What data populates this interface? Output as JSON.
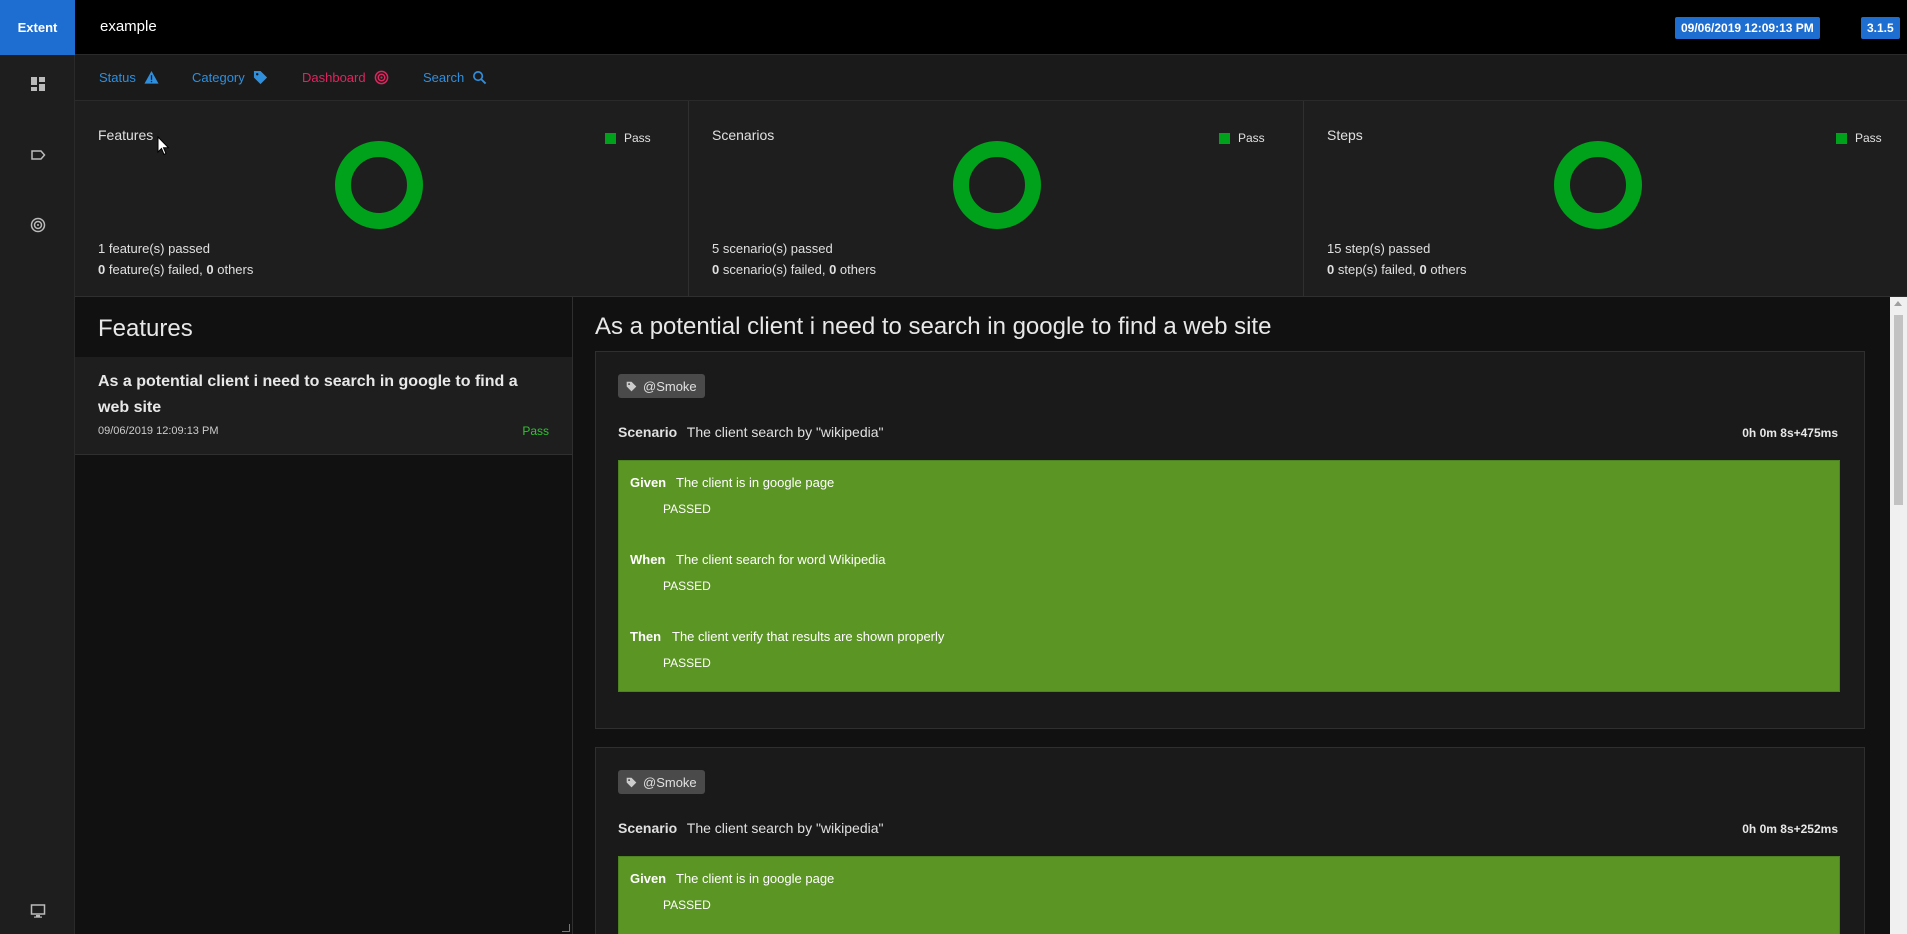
{
  "app": {
    "brand": "Extent",
    "title": "example",
    "timestamp": "09/06/2019 12:09:13 PM",
    "version": "3.1.5"
  },
  "nav": {
    "items": [
      {
        "label": "Status",
        "color": "#2f8fdc",
        "icon": "warning-triangle-icon"
      },
      {
        "label": "Category",
        "color": "#2f8fdc",
        "icon": "tag-icon"
      },
      {
        "label": "Dashboard",
        "color": "#e0245e",
        "icon": "dashboard-radar-icon"
      },
      {
        "label": "Search",
        "color": "#2f8fdc",
        "icon": "search-icon"
      }
    ]
  },
  "sidebar": {
    "icons": [
      "dashboard-grid-icon",
      "label-tag-icon",
      "radar-icon",
      "monitor-icon"
    ]
  },
  "cards": [
    {
      "title": "Features",
      "legend": "Pass",
      "passed_count": "1",
      "passed_text": " feature(s) passed",
      "failed_count": "0",
      "failed_text": " feature(s) failed, ",
      "others_count": "0",
      "others_text": " others"
    },
    {
      "title": "Scenarios",
      "legend": "Pass",
      "passed_count": "5",
      "passed_text": " scenario(s) passed",
      "failed_count": "0",
      "failed_text": " scenario(s) failed, ",
      "others_count": "0",
      "others_text": " others"
    },
    {
      "title": "Steps",
      "legend": "Pass",
      "passed_count": "15",
      "passed_text": " step(s) passed",
      "failed_count": "0",
      "failed_text": " step(s) failed, ",
      "others_count": "0",
      "others_text": " others"
    }
  ],
  "colors": {
    "pass_green": "#00a21b",
    "step_green": "#5b9523",
    "accent_blue": "#1e6ed1"
  },
  "features_panel": {
    "heading": "Features",
    "item": {
      "title": "As a potential client i need to search in google to find a web site",
      "time": "09/06/2019 12:09:13 PM",
      "status": "Pass"
    }
  },
  "detail": {
    "title": "As a potential client i need to search in google to find a web site",
    "scenarios": [
      {
        "tag": "@Smoke",
        "keyword": "Scenario",
        "name": "The client search by \"wikipedia\"",
        "duration": "0h 0m 8s+475ms",
        "steps": [
          {
            "keyword": "Given",
            "text": "The client is in google page",
            "result": "PASSED"
          },
          {
            "keyword": "When",
            "text": "The client search for word Wikipedia",
            "result": "PASSED"
          },
          {
            "keyword": "Then",
            "text": "The client verify that results are shown properly",
            "result": "PASSED"
          }
        ]
      },
      {
        "tag": "@Smoke",
        "keyword": "Scenario",
        "name": "The client search by \"wikipedia\"",
        "duration": "0h 0m 8s+252ms",
        "steps": [
          {
            "keyword": "Given",
            "text": "The client is in google page",
            "result": "PASSED"
          }
        ]
      }
    ]
  }
}
